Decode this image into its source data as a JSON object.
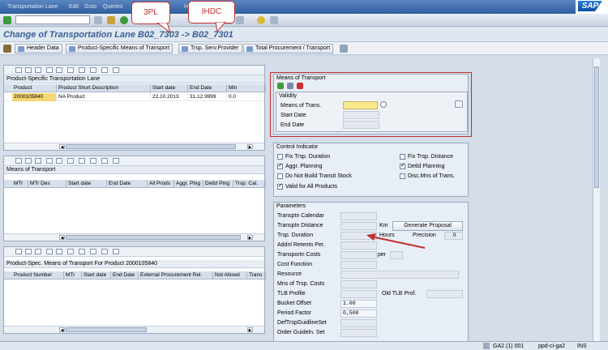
{
  "menu": {
    "items": [
      "Transportation Lane",
      "Edit",
      "Goto",
      "Queries",
      "H",
      "Help"
    ],
    "logo": "SAP"
  },
  "title": "Change of Transportation Lane B02_7303 -> B02_7301",
  "toolbar2": {
    "buttons": [
      "Header Data",
      "Product-Specific Means of Transport",
      "Trsp. Serv.Provider",
      "Total Procurement / Transport"
    ]
  },
  "callouts": {
    "a": "3PL",
    "b": "IHDC"
  },
  "panel1": {
    "title": "Product-Specific Transportation Lane",
    "columns": [
      "Product",
      "Product Short Description",
      "Start date",
      "End Date",
      "Min"
    ],
    "rows": [
      {
        "product": "2000105840",
        "desc": "NA Product",
        "start": "22.10.2013",
        "end": "31.12.9999",
        "min": "0.0"
      }
    ]
  },
  "panel2": {
    "title": "Means of Transport",
    "columns": [
      "MTr",
      "MTr Des",
      "Start date",
      "End Date",
      "All Prods",
      "Aggr. Plng",
      "Detld Plng",
      "Trsp. Cal."
    ]
  },
  "panel3": {
    "title": "Product-Spec. Means of Transport For Product 2000105840",
    "columns": [
      "Product Number",
      "MTr",
      "Start date",
      "End Date",
      "External Procurement Rel.",
      "Not Allowd",
      "Trans"
    ]
  },
  "mot": {
    "title": "Means of Transport",
    "validity": "Validity",
    "labels": [
      "Means of Trans.",
      "Start Date",
      "End Date"
    ]
  },
  "control": {
    "title": "Control Indicator",
    "items": [
      {
        "label": "Fix Trsp. Duration",
        "checked": false
      },
      {
        "label": "Fix Trsp. Distance",
        "checked": false
      },
      {
        "label": "Aggr. Planning",
        "checked": true
      },
      {
        "label": "Detld Planning",
        "checked": true
      },
      {
        "label": "Do Not Build Transit Stock",
        "checked": false
      },
      {
        "label": "Disc.Mns of Trans.",
        "checked": false
      },
      {
        "label": "Valid for All Products",
        "checked": true
      }
    ]
  },
  "params": {
    "title": "Parameters",
    "labels": [
      "Transptn Calendar",
      "Transptn Distance",
      "Trsp. Duration",
      "Addnl Retentn Per.",
      "Transportn Costs",
      "Cost Function",
      "Resource",
      "Mns of Trsp. Costs",
      "TLB Profile",
      "Bucket Offset",
      "Period Factor",
      "DefTrspGuidlineSet",
      "Order Guideln. Set"
    ],
    "unit_km": "Km",
    "unit_hours": "Hours",
    "unit_per": "per",
    "generate": "Generate Proposal",
    "precision_label": "Precision",
    "precision": "0",
    "old_tlb": "Old TLB Prof.",
    "bucket_offset": "1.00",
    "period_factor": "0,500"
  },
  "status": {
    "system": "GA2 (1) 001",
    "server": "ppd-ci-ga2",
    "mode": "INS"
  }
}
